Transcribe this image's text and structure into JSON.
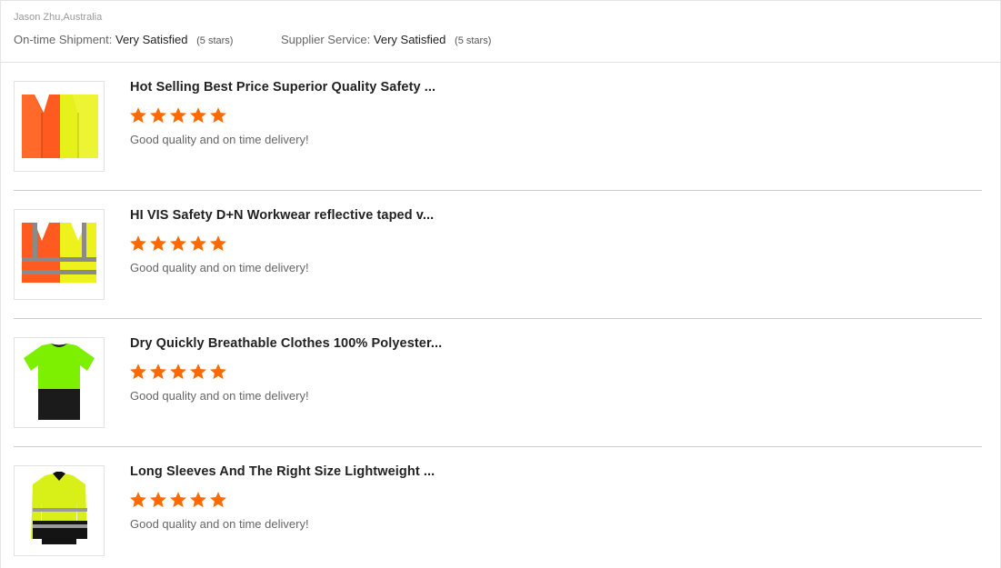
{
  "header": {
    "reviewer": "Jason Zhu,Australia",
    "shipment_label": "On-time Shipment:",
    "shipment_value": "Very Satisfied",
    "shipment_stars": "(5 stars)",
    "service_label": "Supplier Service:",
    "service_value": "Very Satisfied",
    "service_stars": "(5 stars)"
  },
  "colors": {
    "star": "#ff6a00",
    "divider": "#cfcfcf"
  },
  "reviews": [
    {
      "title": "Hot Selling Best Price Superior Quality Safety ...",
      "rating": 5,
      "comment": "Good quality and on time delivery!",
      "thumb_icon": "safety-vest-icon"
    },
    {
      "title": "HI VIS Safety D+N Workwear reflective taped v...",
      "rating": 5,
      "comment": "Good quality and on time delivery!",
      "thumb_icon": "reflective-vest-icon"
    },
    {
      "title": "Dry Quickly Breathable Clothes 100% Polyester...",
      "rating": 5,
      "comment": "Good quality and on time delivery!",
      "thumb_icon": "hivis-tshirt-icon"
    },
    {
      "title": "Long Sleeves And The Right Size Lightweight ...",
      "rating": 5,
      "comment": "Good quality and on time delivery!",
      "thumb_icon": "hivis-longsleeve-icon"
    }
  ]
}
